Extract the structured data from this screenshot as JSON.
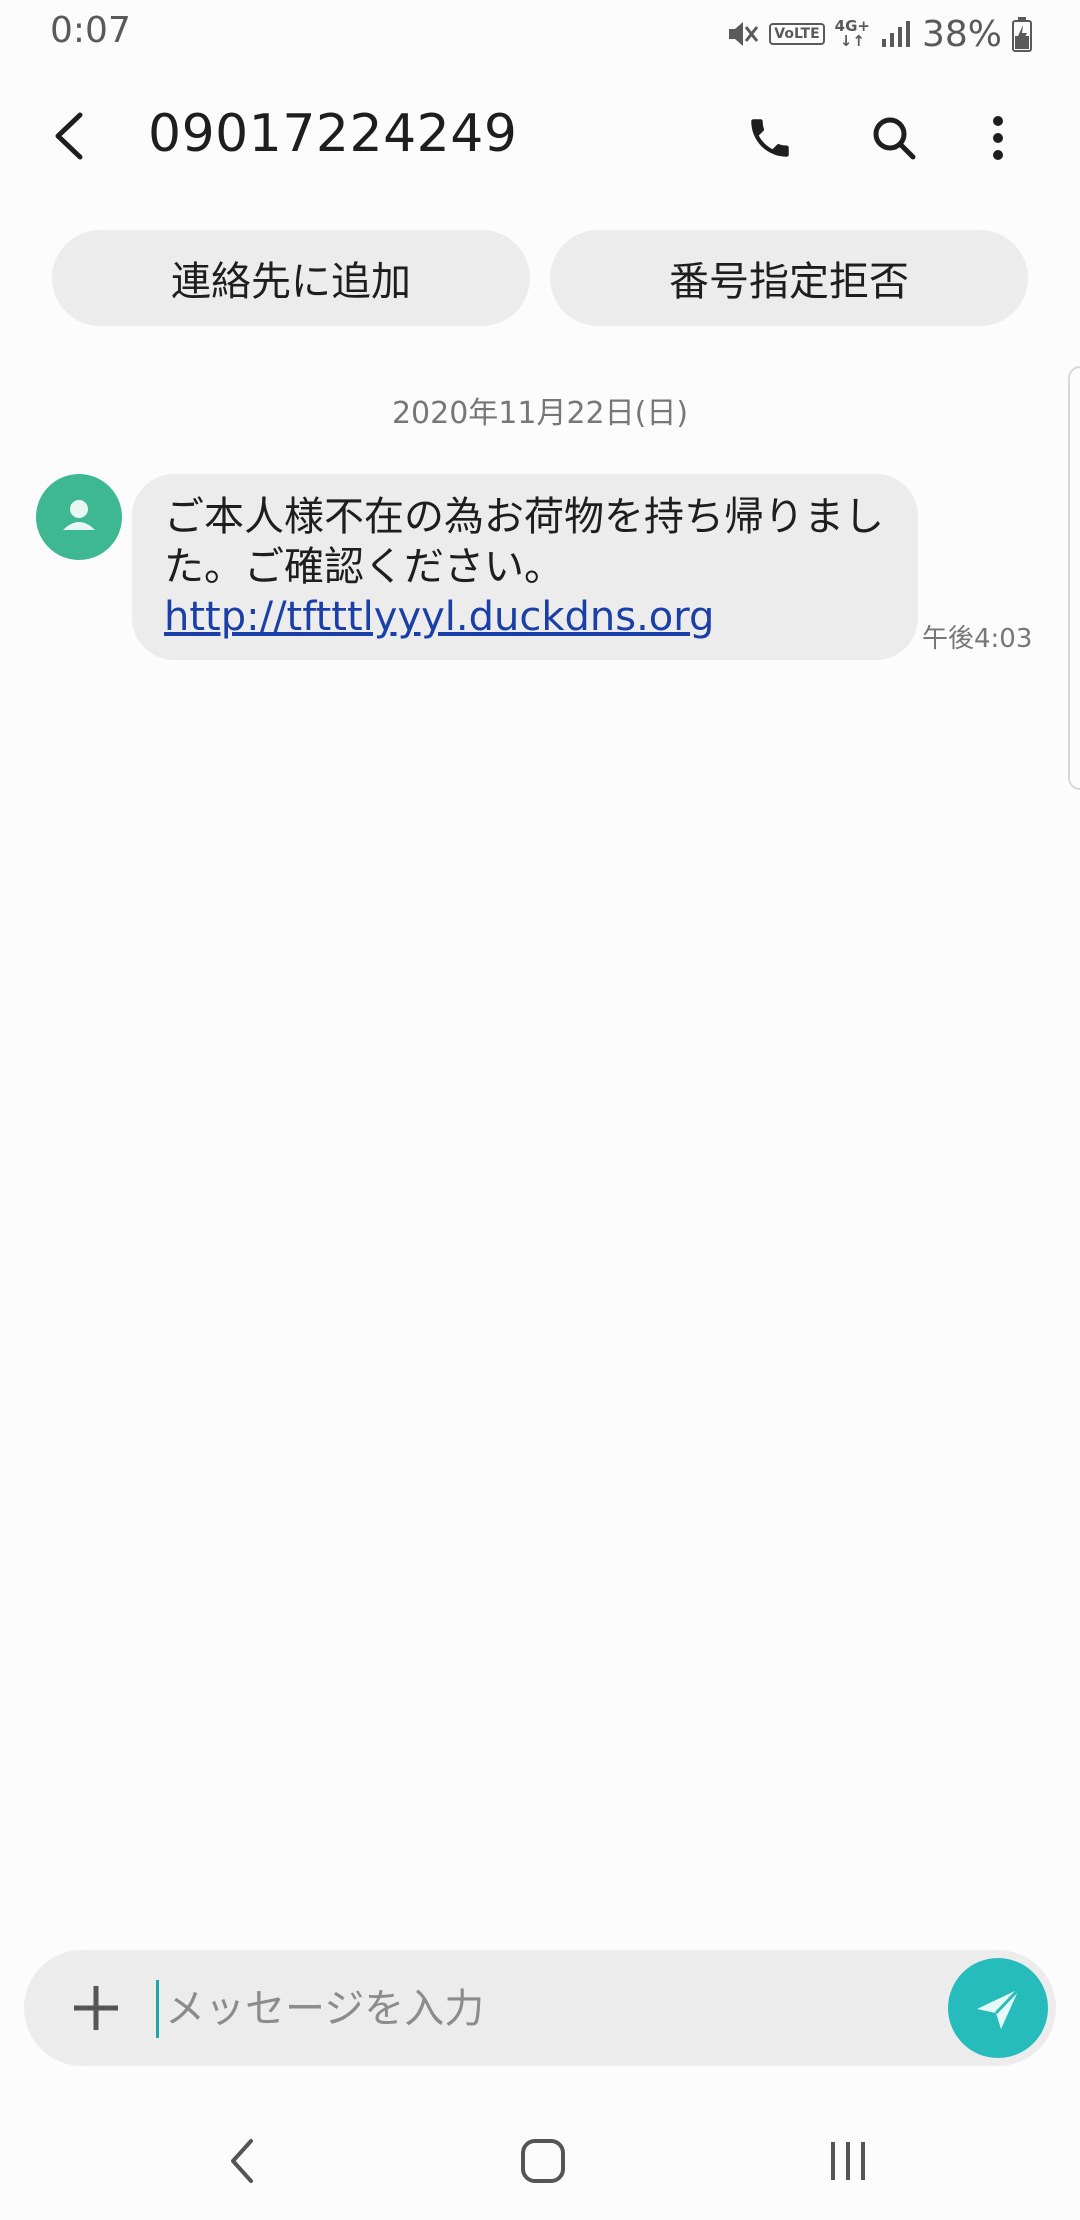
{
  "status_bar": {
    "time": "0:07",
    "volte": "VoLTE",
    "network": "4G+",
    "battery_percent": "38%",
    "icons": [
      "mute-vibrate-icon",
      "volte-icon",
      "4g-plus-icon",
      "signal-icon",
      "battery-charging-icon"
    ]
  },
  "app_bar": {
    "title": "09017224249",
    "icons": [
      "back-arrow-icon",
      "phone-icon",
      "search-icon",
      "more-vertical-icon"
    ]
  },
  "chips": {
    "add_contact": "連絡先に追加",
    "block_number": "番号指定拒否"
  },
  "conversation": {
    "date": "2020年11月22日(日)",
    "messages": [
      {
        "text": "ご本人様不在の為お荷物を持ち帰りました。ご確認ください。",
        "link": "http://tftttlyyyl.duckdns.org",
        "time": "午後4:03"
      }
    ]
  },
  "compose": {
    "placeholder": "メッセージを入力",
    "value": ""
  },
  "colors": {
    "avatar": "#3db892",
    "send_button": "#27bcbc",
    "link": "#1a3fa8",
    "bubble": "#ececec"
  }
}
